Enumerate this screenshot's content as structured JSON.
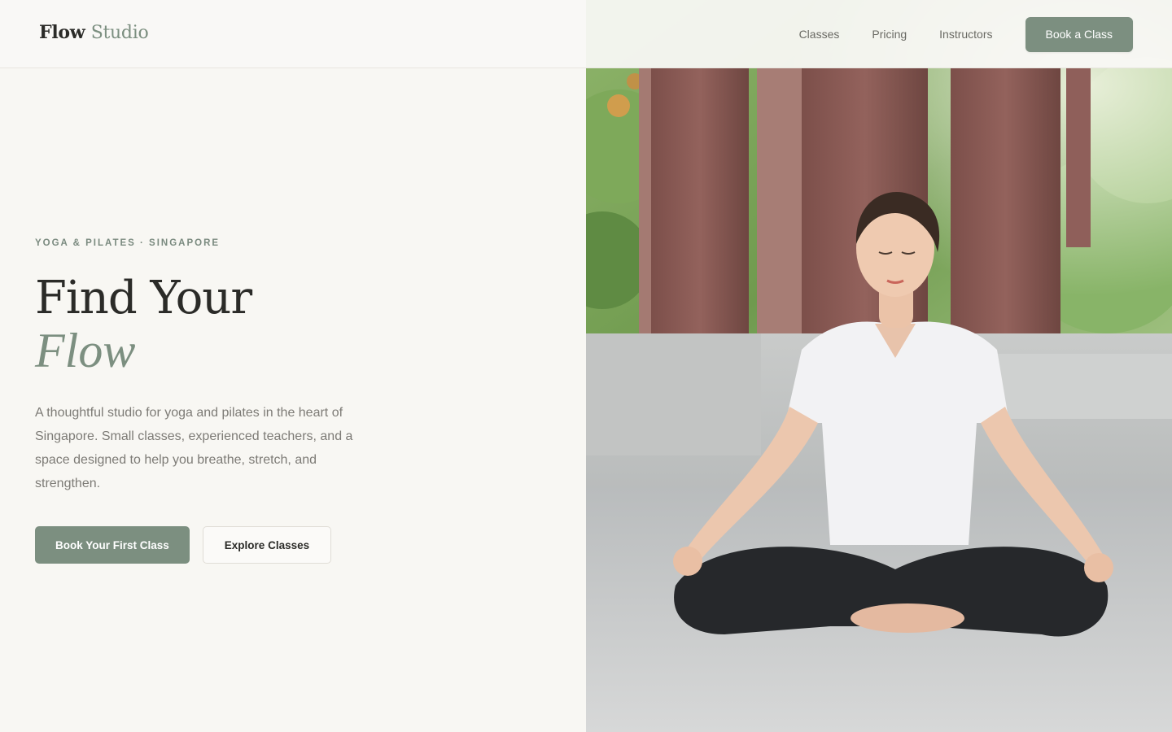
{
  "header": {
    "logo_primary": "Flow",
    "logo_accent": "Studio",
    "nav": [
      {
        "label": "Classes"
      },
      {
        "label": "Pricing"
      },
      {
        "label": "Instructors"
      }
    ],
    "cta_label": "Book a Class"
  },
  "hero": {
    "eyebrow": "YOGA & PILATES · SINGAPORE",
    "headline_line1": "Find Your",
    "headline_line2": "Flow",
    "description": "A thoughtful studio for yoga and pilates in the heart of Singapore. Small classes, experienced teachers, and a space designed to help you breathe, stretch, and strengthen.",
    "primary_cta": "Book Your First Class",
    "secondary_cta": "Explore Classes",
    "image_subject": "woman meditating cross-legged in an open-air studio"
  },
  "colors": {
    "background": "#f8f7f3",
    "accent": "#7c8f80",
    "text": "#2b2b28",
    "muted_text": "#7d7b76"
  }
}
